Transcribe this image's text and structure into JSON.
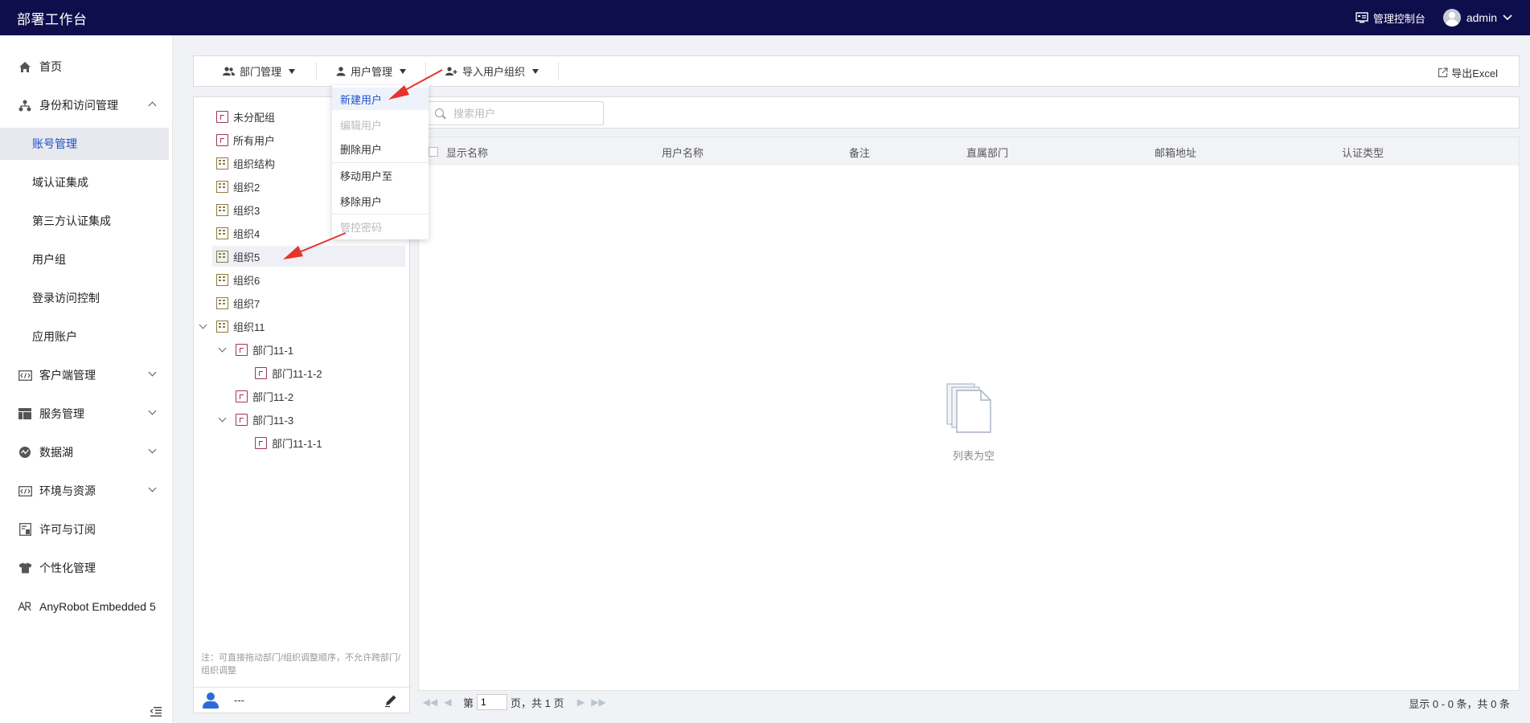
{
  "topbar": {
    "title": "部署工作台",
    "console_label": "管理控制台",
    "user_name": "admin"
  },
  "sidebar": {
    "items": [
      {
        "label": "首页",
        "icon": "home-icon"
      },
      {
        "label": "身份和访问管理",
        "icon": "org-chart-icon",
        "expanded": true
      },
      {
        "label": "客户端管理",
        "icon": "code-window-icon"
      },
      {
        "label": "服务管理",
        "icon": "table-icon"
      },
      {
        "label": "数据湖",
        "icon": "datalake-icon"
      },
      {
        "label": "环境与资源",
        "icon": "code-window-icon"
      },
      {
        "label": "许可与订阅",
        "icon": "license-icon"
      },
      {
        "label": "个性化管理",
        "icon": "shirt-icon"
      },
      {
        "label": "AnyRobot Embedded 5",
        "icon": "anyrobot-icon"
      }
    ],
    "sub_items": [
      {
        "label": "账号管理",
        "active": true
      },
      {
        "label": "域认证集成"
      },
      {
        "label": "第三方认证集成"
      },
      {
        "label": "用户组"
      },
      {
        "label": "登录访问控制"
      },
      {
        "label": "应用账户"
      }
    ]
  },
  "toolbar": {
    "dept_mgmt": "部门管理",
    "user_mgmt": "用户管理",
    "import_org": "导入用户组织",
    "export": "导出Excel"
  },
  "dropdown": {
    "items": [
      {
        "label": "新建用户",
        "state": "active"
      },
      {
        "label": "编辑用户",
        "state": "disabled"
      },
      {
        "label": "删除用户",
        "state": "normal"
      },
      {
        "label": "移动用户至",
        "state": "normal"
      },
      {
        "label": "移除用户",
        "state": "normal"
      },
      {
        "label": "管控密码",
        "state": "disabled"
      }
    ]
  },
  "tree": {
    "nodes": [
      {
        "label": "未分配组",
        "icon": "group"
      },
      {
        "label": "所有用户",
        "icon": "group"
      },
      {
        "label": "组织结构",
        "icon": "org"
      },
      {
        "label": "组织2",
        "icon": "org"
      },
      {
        "label": "组织3",
        "icon": "org"
      },
      {
        "label": "组织4",
        "icon": "org"
      },
      {
        "label": "组织5",
        "icon": "org",
        "selected": true
      },
      {
        "label": "组织6",
        "icon": "org"
      },
      {
        "label": "组织7",
        "icon": "org"
      },
      {
        "label": "组织11",
        "icon": "org",
        "expanded": true
      },
      {
        "label": "部门11-1",
        "icon": "group",
        "expanded": true
      },
      {
        "label": "部门11-1-2",
        "icon": "group"
      },
      {
        "label": "部门11-2",
        "icon": "group"
      },
      {
        "label": "部门11-3",
        "icon": "group",
        "expanded": true
      },
      {
        "label": "部门11-1-1",
        "icon": "group"
      }
    ],
    "note": "注：可直接拖动部门/组织调整顺序，不允许跨部门/组织调整",
    "footer_text": "---"
  },
  "search": {
    "placeholder": "搜索用户"
  },
  "table": {
    "columns": [
      "显示名称",
      "用户名称",
      "备注",
      "直属部门",
      "邮箱地址",
      "认证类型"
    ],
    "rows": [],
    "empty_text": "列表为空"
  },
  "pager": {
    "prefix": "第",
    "current_page": "1",
    "suffix": "页，共 1 页",
    "summary": "显示 0 - 0 条，共 0 条"
  },
  "colors": {
    "topbar_bg": "#0f0e4d",
    "accent": "#1f4fc9",
    "annotation_arrow": "#e8322c"
  }
}
